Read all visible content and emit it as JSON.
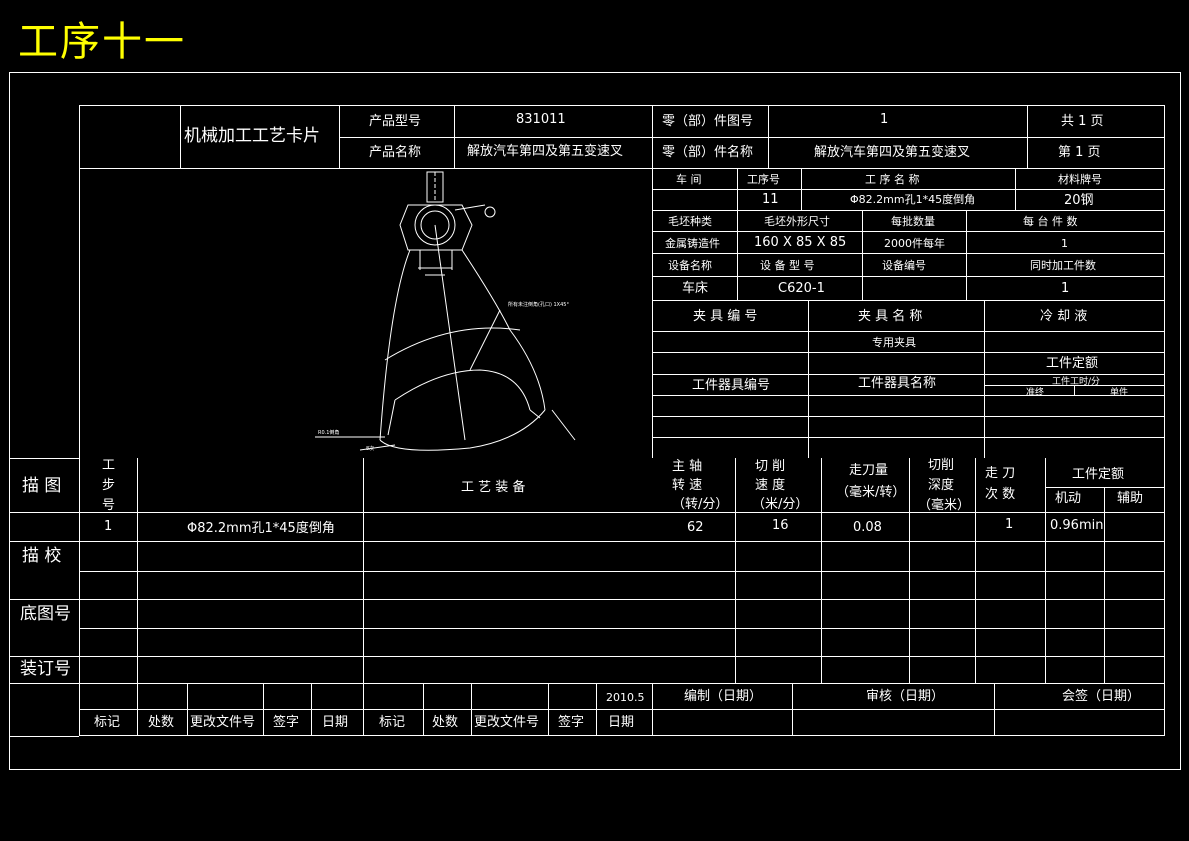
{
  "title": "工序十一",
  "header": {
    "card_title": "机械加工工艺卡片",
    "product_model_label": "产品型号",
    "product_model": "831011",
    "product_name_label": "产品名称",
    "product_name": "解放汽车第四及第五变速叉",
    "part_drawing_no_label": "零（部）件图号",
    "part_drawing_no": "1",
    "part_name_label": "零（部）件名称",
    "part_name": "解放汽车第四及第五变速叉",
    "total_pages": "共  1  页",
    "page_no": "第  1  页"
  },
  "info": {
    "workshop_label": "车  间",
    "process_no_label": "工序号",
    "process_name_label": "工  序  名  称",
    "material_label": "材料牌号",
    "workshop": "",
    "process_no": "11",
    "process_name": "Φ82.2mm孔1*45度倒角",
    "material": "20钢",
    "blank_type_label": "毛坯种类",
    "blank_size_label": "毛坯外形尺寸",
    "batch_label": "每批数量",
    "per_unit_label": "每  台  件  数",
    "blank_type": "金属铸造件",
    "blank_size": "160 X 85 X 85",
    "batch": "2000件每年",
    "per_unit": "1",
    "equip_name_label": "设备名称",
    "equip_model_label": "设  备  型  号",
    "equip_no_label": "设备编号",
    "simul_label": "同时加工件数",
    "equip_name": "车床",
    "equip_model": "C620-1",
    "equip_no": "",
    "simul": "1",
    "fixture_no_label": "夹 具 编 号",
    "fixture_name_label": "夹 具 名 称",
    "coolant_label": "冷  却  液",
    "fixture_name": "专用夹具",
    "quota_label": "工件定额",
    "tool_no_label": "工件器具编号",
    "tool_name_label": "工件器具名称",
    "quota_sub_label": "工件工时/分",
    "quota_prep_label": "准终",
    "quota_single_label": "单件"
  },
  "drawing_annotations": [
    "所有未注倒角(孔口) 1X45°",
    "R0.1倒角",
    "8次"
  ],
  "steps": {
    "sketch_label": "描 图",
    "step_label": [
      "工",
      "步",
      "号"
    ],
    "equipment_label": "工 艺 装 备",
    "spindle_label": [
      "主    轴",
      "转    速",
      "（转/分）"
    ],
    "cut_speed_label": [
      "切    削",
      "速    度",
      "（米/分）"
    ],
    "feed_label": [
      "走刀量",
      "（毫米/转）"
    ],
    "depth_label": [
      "切削",
      "深度",
      "（毫米）"
    ],
    "passes_label": [
      "走    刀",
      "次    数"
    ],
    "quota_label": "工件定额",
    "machine_label": "机动",
    "aux_label": "辅助",
    "rows": [
      {
        "step": "1",
        "content": "Φ82.2mm孔1*45度倒角",
        "spindle": "62",
        "speed": "16",
        "feed": "0.08",
        "depth": "",
        "passes": "1",
        "machine_time": "0.96min",
        "aux_time": ""
      }
    ],
    "check_label": "描 校",
    "base_drawing_label": "底图号",
    "binding_label": "装订号"
  },
  "footer": {
    "date": "2010.5",
    "compile_label": "编制（日期）",
    "review_label": "审核（日期）",
    "countersign_label": "会签（日期）",
    "mark_label": "标记",
    "count_label": "处数",
    "change_doc_label": "更改文件号",
    "sign_label": "签字",
    "date_label": "日期"
  }
}
